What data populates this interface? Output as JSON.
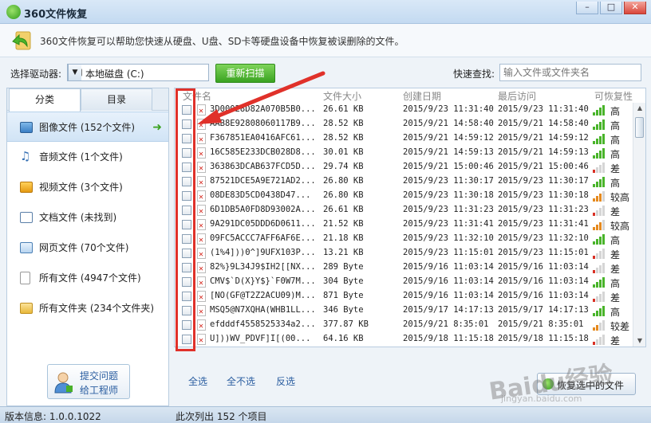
{
  "window": {
    "title": "360文件恢复",
    "min": "–",
    "max": "□",
    "close": "✕"
  },
  "banner": {
    "text": "360文件恢复可以帮助您快速从硬盘、U盘、SD卡等硬盘设备中恢复被误删除的文件。"
  },
  "toolbar": {
    "drive_label": "选择驱动器:",
    "drive_value": "本地磁盘 (C:)",
    "rescan_label": "重新扫描",
    "quicksearch_label": "快速查找:",
    "quicksearch_placeholder": "输入文件或文件夹名"
  },
  "sidebar": {
    "tabs": [
      {
        "label": "分类"
      },
      {
        "label": "目录"
      }
    ],
    "categories": [
      {
        "label": "图像文件 (152个文件)",
        "icon": "image-icon",
        "selected": true
      },
      {
        "label": "音频文件 (1个文件)",
        "icon": "music-icon"
      },
      {
        "label": "视频文件 (3个文件)",
        "icon": "video-icon"
      },
      {
        "label": "文档文件 (未找到)",
        "icon": "document-icon"
      },
      {
        "label": "网页文件 (70个文件)",
        "icon": "webpage-icon"
      },
      {
        "label": "所有文件 (4947个文件)",
        "icon": "file-icon"
      },
      {
        "label": "所有文件夹 (234个文件夹)",
        "icon": "folder-icon"
      }
    ],
    "report": {
      "line1": "提交问题",
      "line2": "给工程师"
    }
  },
  "table": {
    "columns": {
      "name": "文件名",
      "size": "文件大小",
      "created": "创建日期",
      "accessed": "最后访问",
      "recoverability": "可恢复性"
    },
    "rows": [
      {
        "name": "3D00028D82A070B5B0...",
        "size": "26.61 KB",
        "created": "2015/9/23 11:31:40",
        "accessed": "2015/9/23 11:31:40",
        "rec": "高",
        "level": 4
      },
      {
        "name": "AAB8E92808060117B9...",
        "size": "28.52 KB",
        "created": "2015/9/21 14:58:40",
        "accessed": "2015/9/21 14:58:40",
        "rec": "高",
        "level": 4
      },
      {
        "name": "F367851EA0416AFC61...",
        "size": "28.52 KB",
        "created": "2015/9/21 14:59:12",
        "accessed": "2015/9/21 14:59:12",
        "rec": "高",
        "level": 4
      },
      {
        "name": "16C585E233DCB028D8...",
        "size": "30.01 KB",
        "created": "2015/9/21 14:59:13",
        "accessed": "2015/9/21 14:59:13",
        "rec": "高",
        "level": 4
      },
      {
        "name": "363863DCAB637FCD5D...",
        "size": "29.74 KB",
        "created": "2015/9/21 15:00:46",
        "accessed": "2015/9/21 15:00:46",
        "rec": "差",
        "level": 1
      },
      {
        "name": "87521DCE5A9E721AD2...",
        "size": "26.80 KB",
        "created": "2015/9/23 11:30:17",
        "accessed": "2015/9/23 11:30:17",
        "rec": "高",
        "level": 4
      },
      {
        "name": "08DE83D5CD0438D47...",
        "size": "26.80 KB",
        "created": "2015/9/23 11:30:18",
        "accessed": "2015/9/23 11:30:18",
        "rec": "较高",
        "level": 3
      },
      {
        "name": "6D1DB5A0FD8D93002A...",
        "size": "26.61 KB",
        "created": "2015/9/23 11:31:23",
        "accessed": "2015/9/23 11:31:23",
        "rec": "差",
        "level": 1
      },
      {
        "name": "9A291DC05DDD6D0611...",
        "size": "21.52 KB",
        "created": "2015/9/23 11:31:41",
        "accessed": "2015/9/23 11:31:41",
        "rec": "较高",
        "level": 3
      },
      {
        "name": "09FC5ACCC7AFF6AF6E...",
        "size": "21.18 KB",
        "created": "2015/9/23 11:32:10",
        "accessed": "2015/9/23 11:32:10",
        "rec": "高",
        "level": 4
      },
      {
        "name": "(1%4]))0^]9UFX103P...",
        "size": "13.21 KB",
        "created": "2015/9/23 11:15:01",
        "accessed": "2015/9/23 11:15:01",
        "rec": "差",
        "level": 1
      },
      {
        "name": "82%}9L34J9$IH2[[NX...",
        "size": "289 Byte",
        "created": "2015/9/16 11:03:14",
        "accessed": "2015/9/16 11:03:14",
        "rec": "差",
        "level": 1
      },
      {
        "name": "CMV$`D(X}Y$}`F0W7M...",
        "size": "304 Byte",
        "created": "2015/9/16 11:03:14",
        "accessed": "2015/9/16 11:03:14",
        "rec": "高",
        "level": 4
      },
      {
        "name": "[NO(GF@T2Z2ACU09)M...",
        "size": "871 Byte",
        "created": "2015/9/16 11:03:14",
        "accessed": "2015/9/16 11:03:14",
        "rec": "差",
        "level": 1
      },
      {
        "name": "MSQ5@N7XQHA(WHB1LL...",
        "size": "346 Byte",
        "created": "2015/9/17 14:17:13",
        "accessed": "2015/9/17 14:17:13",
        "rec": "高",
        "level": 4
      },
      {
        "name": "efdddf4558525334a2...",
        "size": "377.87 KB",
        "created": "2015/9/21 8:35:01",
        "accessed": "2015/9/21 8:35:01",
        "rec": "较差",
        "level": 2
      },
      {
        "name": "U]))WV_PDVF]I[(00...",
        "size": "64.16 KB",
        "created": "2015/9/18 11:15:18",
        "accessed": "2015/9/18 11:15:18",
        "rec": "差",
        "level": 1
      }
    ]
  },
  "actions": {
    "select_all": "全选",
    "select_none": "全不选",
    "invert": "反选",
    "recover": "恢复选中的文件"
  },
  "status": {
    "version": "版本信息: 1.0.0.1022",
    "count": "此次列出 152 个项目"
  },
  "watermark": {
    "text": "Baidu经验",
    "url": "jingyan.baidu.com"
  },
  "colors": {
    "accent_green": "#3aa321",
    "annotation_red": "#e0312a",
    "bar_green": "#49b42a",
    "bar_orange": "#e58a1f",
    "bar_red": "#d93025"
  }
}
